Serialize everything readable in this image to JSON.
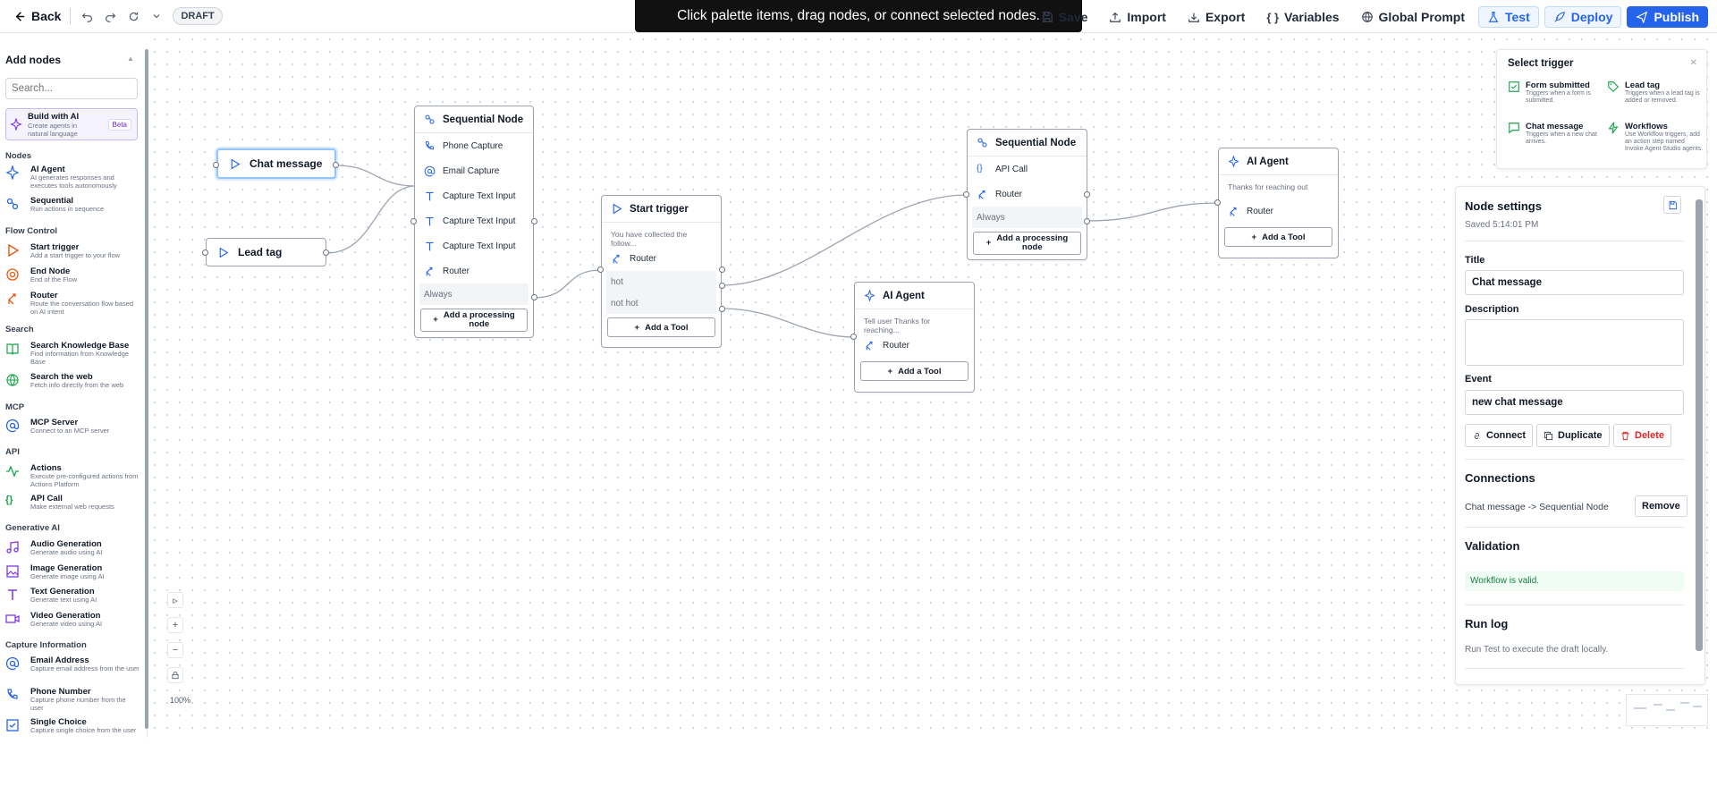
{
  "topbar": {
    "back": "Back",
    "badge": "DRAFT",
    "toast": "Click palette items, drag nodes, or connect selected nodes.",
    "save": "Save",
    "import": "Import",
    "export": "Export",
    "variables": "Variables",
    "global_prompt": "Global Prompt",
    "test": "Test",
    "deploy": "Deploy",
    "publish": "Publish"
  },
  "sidebar": {
    "title": "Add nodes",
    "search_placeholder": "Search...",
    "build_ai": {
      "title": "Build with AI",
      "desc": "Create agents in natural language",
      "badge": "Beta"
    },
    "categories": {
      "nodes": "Nodes",
      "flow": "Flow Control",
      "search": "Search",
      "mcp": "MCP",
      "api": "API",
      "genai": "Generative AI",
      "capture": "Capture Information"
    },
    "items": [
      {
        "title": "AI Agent",
        "desc": "AI generates responses and executes tools autonomously"
      },
      {
        "title": "Sequential",
        "desc": "Run actions in sequence"
      },
      {
        "title": "Start trigger",
        "desc": "Add a start trigger to your flow"
      },
      {
        "title": "End Node",
        "desc": "End of the Flow"
      },
      {
        "title": "Router",
        "desc": "Route the conversation flow based on AI intent"
      },
      {
        "title": "Search Knowledge Base",
        "desc": "Find information from Knowledge Base"
      },
      {
        "title": "Search the web",
        "desc": "Fetch info directly from the web"
      },
      {
        "title": "MCP Server",
        "desc": "Connect to an MCP server"
      },
      {
        "title": "Actions",
        "desc": "Execute pre-configured actions from Actions Platform"
      },
      {
        "title": "API Call",
        "desc": "Make external web requests"
      },
      {
        "title": "Audio Generation",
        "desc": "Generate audio using AI"
      },
      {
        "title": "Image Generation",
        "desc": "Generate image using AI"
      },
      {
        "title": "Text Generation",
        "desc": "Generate text using AI"
      },
      {
        "title": "Video Generation",
        "desc": "Generate video using AI"
      },
      {
        "title": "Email Address",
        "desc": "Capture email address from the user"
      },
      {
        "title": "Phone Number",
        "desc": "Capture phone number from the user"
      },
      {
        "title": "Single Choice",
        "desc": "Capture single choice from the user"
      }
    ]
  },
  "canvas": {
    "zoom": "100%",
    "triggers": {
      "chat": "Chat message",
      "lead": "Lead tag"
    },
    "seq1": {
      "title": "Sequential Node",
      "rows": [
        "Phone Capture",
        "Email Capture",
        "Capture Text Input",
        "Capture Text Input",
        "Capture Text Input",
        "Router"
      ],
      "always": "Always",
      "add": "Add a processing node"
    },
    "start": {
      "title": "Start trigger",
      "desc": "You have collected the follow...",
      "router": "Router",
      "hot": "hot",
      "nothot": "not hot",
      "add": "Add a Tool"
    },
    "seq2": {
      "title": "Sequential Node",
      "rows": [
        "API Call",
        "Router"
      ],
      "always": "Always",
      "add": "Add a processing node"
    },
    "agent1": {
      "title": "AI Agent",
      "desc": "Tell user Thanks for reaching...",
      "router": "Router",
      "add": "Add a Tool"
    },
    "agent2": {
      "title": "AI Agent",
      "desc": "Thanks for reaching out",
      "router": "Router",
      "add": "Add a Tool"
    }
  },
  "trigger_panel": {
    "title": "Select trigger",
    "options": [
      {
        "title": "Form submitted",
        "desc": "Triggers when a form is submitted."
      },
      {
        "title": "Lead tag",
        "desc": "Triggers when a lead tag is added or removed."
      },
      {
        "title": "Chat message",
        "desc": "Triggers when a new chat arrives."
      },
      {
        "title": "Workflows",
        "desc": "Use Workflow triggers, add an action step named Invoke Agent Studio agents."
      }
    ]
  },
  "settings": {
    "title": "Node settings",
    "saved": "Saved 5:14:01 PM",
    "title_label": "Title",
    "title_value": "Chat message",
    "description_label": "Description",
    "event_label": "Event",
    "event_value": "new chat message",
    "connect": "Connect",
    "duplicate": "Duplicate",
    "delete": "Delete",
    "connections_title": "Connections",
    "connection": "Chat message -> Sequential Node",
    "remove": "Remove",
    "validation_title": "Validation",
    "validation_msg": "Workflow is valid.",
    "runlog_title": "Run log",
    "runlog_msg": "Run Test to execute the draft locally."
  },
  "colors": {
    "accent": "#2563eb",
    "ai": "#7c3aed",
    "danger": "#dc2626",
    "success": "#16a34a"
  }
}
